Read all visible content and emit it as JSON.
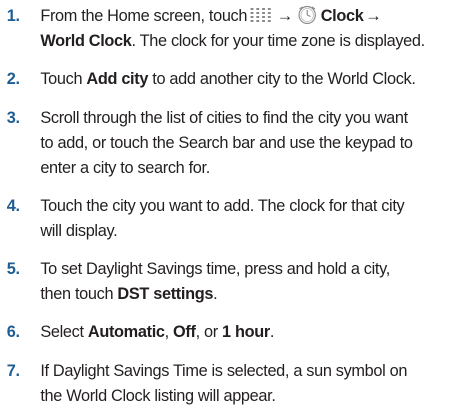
{
  "steps": [
    {
      "number": "1.",
      "line1": {
        "a": "From the Home screen, touch",
        "arrow1": "→",
        "b": "Clock",
        "arrow2": "→"
      },
      "line2": {
        "a": "World Clock",
        "b": ". The clock for your time zone is displayed."
      },
      "icons": [
        "apps-grid-icon",
        "clock-icon"
      ]
    },
    {
      "number": "2.",
      "a": "Touch ",
      "b": "Add city",
      "c": " to add another city to the World Clock."
    },
    {
      "number": "3.",
      "lines": [
        "Scroll through the list of cities to find the city you want",
        "to add, or touch the Search bar and use the keypad to",
        "enter a city to search for."
      ]
    },
    {
      "number": "4.",
      "lines": [
        "Touch the city you want to add. The clock for that city",
        "will display."
      ]
    },
    {
      "number": "5.",
      "line1": "To set Daylight Savings time, press and hold a city,",
      "line2": {
        "a": "then touch ",
        "b": "DST settings",
        "c": "."
      }
    },
    {
      "number": "6.",
      "a": "Select ",
      "b": "Automatic",
      "c": ", ",
      "d": "Off",
      "e": ", or ",
      "f": "1 hour",
      "g": "."
    },
    {
      "number": "7.",
      "lines": [
        "If Daylight Savings Time is selected, a sun symbol on",
        "the World Clock listing will appear."
      ]
    }
  ],
  "colors": {
    "number": "#1f5d93",
    "text": "#231f20",
    "icon": "#8a8a8a"
  }
}
